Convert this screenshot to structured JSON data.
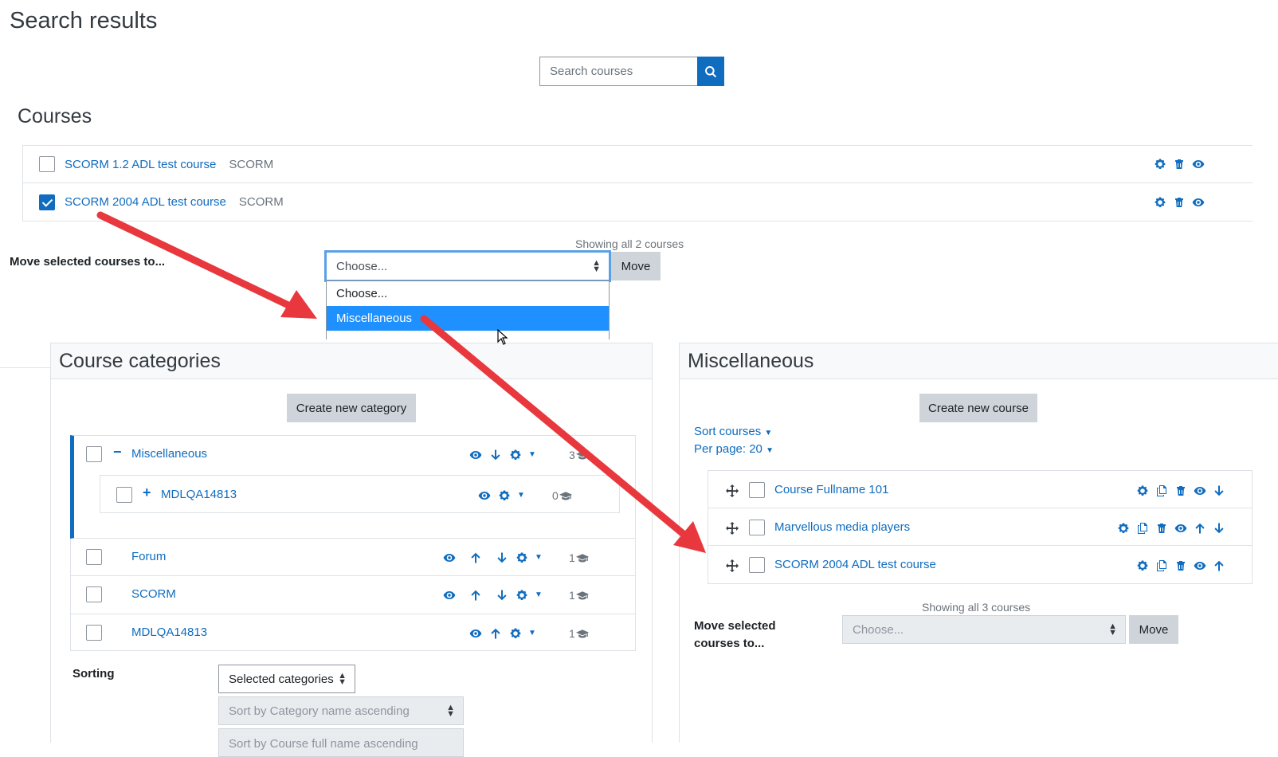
{
  "page": {
    "title": "Search results"
  },
  "search": {
    "placeholder": "Search courses"
  },
  "courses_section": {
    "title": "Courses",
    "items": [
      {
        "name": "SCORM 1.2 ADL test course",
        "category": "SCORM",
        "checked": false
      },
      {
        "name": "SCORM 2004 ADL test course",
        "category": "SCORM",
        "checked": true
      }
    ],
    "showing": "Showing all 2 courses",
    "move_label": "Move selected courses to...",
    "move_select_value": "Choose...",
    "move_button": "Move",
    "dropdown_options": [
      "Choose...",
      "Miscellaneous"
    ],
    "dropdown_selected": "Miscellaneous"
  },
  "categories_panel": {
    "title": "Course categories",
    "create_button": "Create new category",
    "items": [
      {
        "name": "Miscellaneous",
        "toggle": "−",
        "count": "3"
      },
      {
        "name": "MDLQA14813",
        "toggle": "+",
        "count": "0"
      },
      {
        "name": "Forum",
        "count": "1"
      },
      {
        "name": "SCORM",
        "count": "1"
      },
      {
        "name": "MDLQA14813",
        "count": "1"
      }
    ],
    "sorting_label": "Sorting",
    "sort_scope": "Selected categories",
    "sort_category": "Sort by Category name ascending",
    "sort_course": "Sort by Course full name ascending"
  },
  "misc_panel": {
    "title": "Miscellaneous",
    "create_button": "Create new course",
    "sort_courses": "Sort courses",
    "per_page": "Per page: 20",
    "items": [
      {
        "name": "Course Fullname 101"
      },
      {
        "name": "Marvellous media players"
      },
      {
        "name": "SCORM 2004 ADL test course"
      }
    ],
    "showing": "Showing all 3 courses",
    "move_label_1": "Move selected",
    "move_label_2": "courses to...",
    "move_select_value": "Choose...",
    "move_button": "Move"
  },
  "colors": {
    "link": "#0f6cbf",
    "annotation_arrow": "#e8383d",
    "dropdown_highlight": "#1e90ff"
  }
}
